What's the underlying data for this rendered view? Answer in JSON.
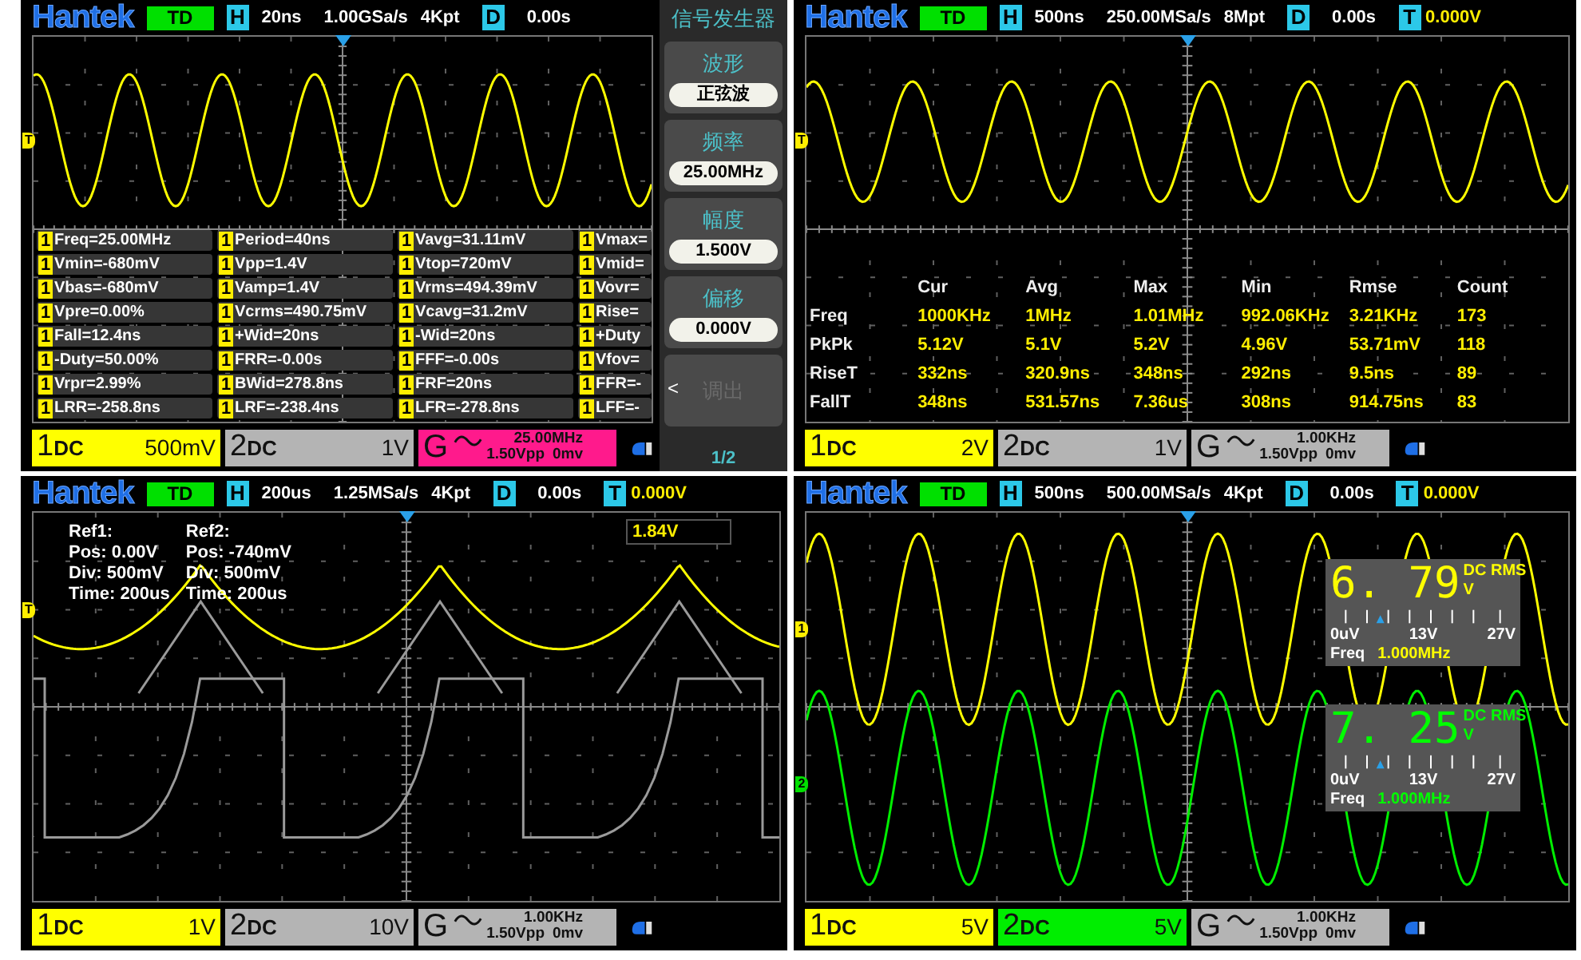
{
  "panels": [
    {
      "kind": "measurements",
      "header": {
        "logo": "Hantek",
        "mode": "TD",
        "h_label": "H",
        "timebase": "20ns",
        "sample_rate": "1.00GSa/s",
        "memory": "4Kpt",
        "d_label": "D",
        "delay": "0.00s"
      },
      "markers": [
        {
          "label": "T",
          "color": "#ffee00"
        }
      ],
      "measurements": [
        [
          {
            "channel": "1",
            "text": "Freq=25.00MHz"
          },
          {
            "channel": "1",
            "text": "Vmin=-680mV"
          },
          {
            "channel": "1",
            "text": "Vbas=-680mV"
          },
          {
            "channel": "1",
            "text": "Vpre=0.00%"
          },
          {
            "channel": "1",
            "text": "Fall=12.4ns"
          },
          {
            "channel": "1",
            "text": "-Duty=50.00%"
          },
          {
            "channel": "1",
            "text": "Vrpr=2.99%"
          },
          {
            "channel": "1",
            "text": "LRR=-258.8ns"
          }
        ],
        [
          {
            "channel": "1",
            "text": "Period=40ns"
          },
          {
            "channel": "1",
            "text": "Vpp=1.4V"
          },
          {
            "channel": "1",
            "text": "Vamp=1.4V"
          },
          {
            "channel": "1",
            "text": "Vcrms=490.75mV"
          },
          {
            "channel": "1",
            "text": "+Wid=20ns"
          },
          {
            "channel": "1",
            "text": "FRR=-0.00s"
          },
          {
            "channel": "1",
            "text": "BWid=278.8ns"
          },
          {
            "channel": "1",
            "text": "LRF=-238.4ns"
          }
        ],
        [
          {
            "channel": "1",
            "text": "Vavg=31.11mV"
          },
          {
            "channel": "1",
            "text": "Vtop=720mV"
          },
          {
            "channel": "1",
            "text": "Vrms=494.39mV"
          },
          {
            "channel": "1",
            "text": "Vcavg=31.2mV"
          },
          {
            "channel": "1",
            "text": "-Wid=20ns"
          },
          {
            "channel": "1",
            "text": "FFF=-0.00s"
          },
          {
            "channel": "1",
            "text": "FRF=20ns"
          },
          {
            "channel": "1",
            "text": "LFR=-278.8ns"
          }
        ],
        [
          {
            "channel": "1",
            "text": "Vmax="
          },
          {
            "channel": "1",
            "text": "Vmid="
          },
          {
            "channel": "1",
            "text": "Vovr="
          },
          {
            "channel": "1",
            "text": "Rise="
          },
          {
            "channel": "1",
            "text": "+Duty"
          },
          {
            "channel": "1",
            "text": "Vfov="
          },
          {
            "channel": "1",
            "text": "FFR=-"
          },
          {
            "channel": "1",
            "text": "LFF=-"
          }
        ]
      ],
      "footer": {
        "channels": [
          {
            "number": "1",
            "coupling": "DC",
            "scale": "500mV",
            "color": "#ffff00"
          },
          {
            "number": "2",
            "coupling": "DC",
            "scale": "1V",
            "color": "#b4b4b4"
          }
        ],
        "generator": {
          "label": "G",
          "frequency": "25.00MHz",
          "amplitude": "1.50Vpp",
          "offset": "0mv",
          "color": "#ff1a8c"
        }
      },
      "menu": {
        "title": "信号发生器",
        "items": [
          {
            "label": "波形",
            "value": "正弦波",
            "disabled": false
          },
          {
            "label": "频率",
            "value": "25.00MHz",
            "disabled": false
          },
          {
            "label": "幅度",
            "value": "1.500V",
            "disabled": false
          },
          {
            "label": "偏移",
            "value": "0.000V",
            "disabled": false
          },
          {
            "label": "调出",
            "arrow": "<",
            "disabled": true
          }
        ],
        "page": "1/2"
      }
    },
    {
      "kind": "statistics",
      "header": {
        "logo": "Hantek",
        "mode": "TD",
        "h_label": "H",
        "timebase": "500ns",
        "sample_rate": "250.00MSa/s",
        "memory": "8Mpt",
        "d_label": "D",
        "delay": "0.00s",
        "trigger": {
          "label": "T",
          "level": "0.000V"
        }
      },
      "markers": [
        {
          "label": "T",
          "color": "#ffee00"
        }
      ],
      "statistics": {
        "columns": [
          "Cur",
          "Avg",
          "Max",
          "Min",
          "Rmse",
          "Count"
        ],
        "rows": [
          {
            "name": "Freq",
            "values": [
              "1000KHz",
              "1MHz",
              "1.01MHz",
              "992.06KHz",
              "3.21KHz",
              "173"
            ]
          },
          {
            "name": "PkPk",
            "values": [
              "5.12V",
              "5.1V",
              "5.2V",
              "4.96V",
              "53.71mV",
              "118"
            ]
          },
          {
            "name": "RiseT",
            "values": [
              "332ns",
              "320.9ns",
              "348ns",
              "292ns",
              "9.5ns",
              "89"
            ]
          },
          {
            "name": "FallT",
            "values": [
              "348ns",
              "531.57ns",
              "7.36us",
              "308ns",
              "914.75ns",
              "83"
            ]
          }
        ]
      },
      "footer": {
        "channels": [
          {
            "number": "1",
            "coupling": "DC",
            "scale": "2V",
            "color": "#ffff00"
          },
          {
            "number": "2",
            "coupling": "DC",
            "scale": "1V",
            "color": "#b4b4b4"
          }
        ],
        "generator": {
          "label": "G",
          "frequency": "1.00KHz",
          "amplitude": "1.50Vpp",
          "offset": "0mv",
          "color": "#b4b4b4"
        }
      }
    },
    {
      "kind": "reference",
      "header": {
        "logo": "Hantek",
        "mode": "TD",
        "h_label": "H",
        "timebase": "200us",
        "sample_rate": "1.25MSa/s",
        "memory": "4Kpt",
        "d_label": "D",
        "delay": "0.00s",
        "trigger": {
          "label": "T",
          "level": "0.000V"
        }
      },
      "markers": [
        {
          "label": "T",
          "color": "#ffee00"
        }
      ],
      "references": [
        {
          "title": "Ref1:",
          "lines": [
            "Pos: 0.00V",
            "Div: 500mV",
            "Time: 200us"
          ]
        },
        {
          "title": "Ref2:",
          "lines": [
            "Pos: -740mV",
            "Div: 500mV",
            "Time: 200us"
          ]
        }
      ],
      "cursor_reading": "1.84V",
      "footer": {
        "channels": [
          {
            "number": "1",
            "coupling": "DC",
            "scale": "1V",
            "color": "#ffff00"
          },
          {
            "number": "2",
            "coupling": "DC",
            "scale": "10V",
            "color": "#b4b4b4"
          }
        ],
        "generator": {
          "label": "G",
          "frequency": "1.00KHz",
          "amplitude": "1.50Vpp",
          "offset": "0mv",
          "color": "#b4b4b4"
        }
      }
    },
    {
      "kind": "meter",
      "header": {
        "logo": "Hantek",
        "mode": "TD",
        "h_label": "H",
        "timebase": "500ns",
        "sample_rate": "500.00MSa/s",
        "memory": "4Kpt",
        "d_label": "D",
        "delay": "0.00s",
        "trigger": {
          "label": "T",
          "level": "0.000V"
        }
      },
      "markers": [
        {
          "label": "1",
          "color": "#ffee00"
        },
        {
          "label": "2",
          "color": "#00e000"
        }
      ],
      "meters": [
        {
          "value": "6. 79",
          "mode": "DC RMS",
          "unit": "V",
          "scale": [
            "0uV",
            "13V",
            "27V"
          ],
          "freq_label": "Freq",
          "freq": "1.000MHz",
          "color": "#ffff00"
        },
        {
          "value": "7. 25",
          "mode": "DC RMS",
          "unit": "V",
          "scale": [
            "0uV",
            "13V",
            "27V"
          ],
          "freq_label": "Freq",
          "freq": "1.000MHz",
          "color": "#00ff00"
        }
      ],
      "footer": {
        "channels": [
          {
            "number": "1",
            "coupling": "DC",
            "scale": "5V",
            "color": "#ffff00"
          },
          {
            "number": "2",
            "coupling": "DC",
            "scale": "5V",
            "color": "#00ee00"
          }
        ],
        "generator": {
          "label": "G",
          "frequency": "1.00KHz",
          "amplitude": "1.50Vpp",
          "offset": "0mv",
          "color": "#b4b4b4"
        }
      }
    }
  ]
}
